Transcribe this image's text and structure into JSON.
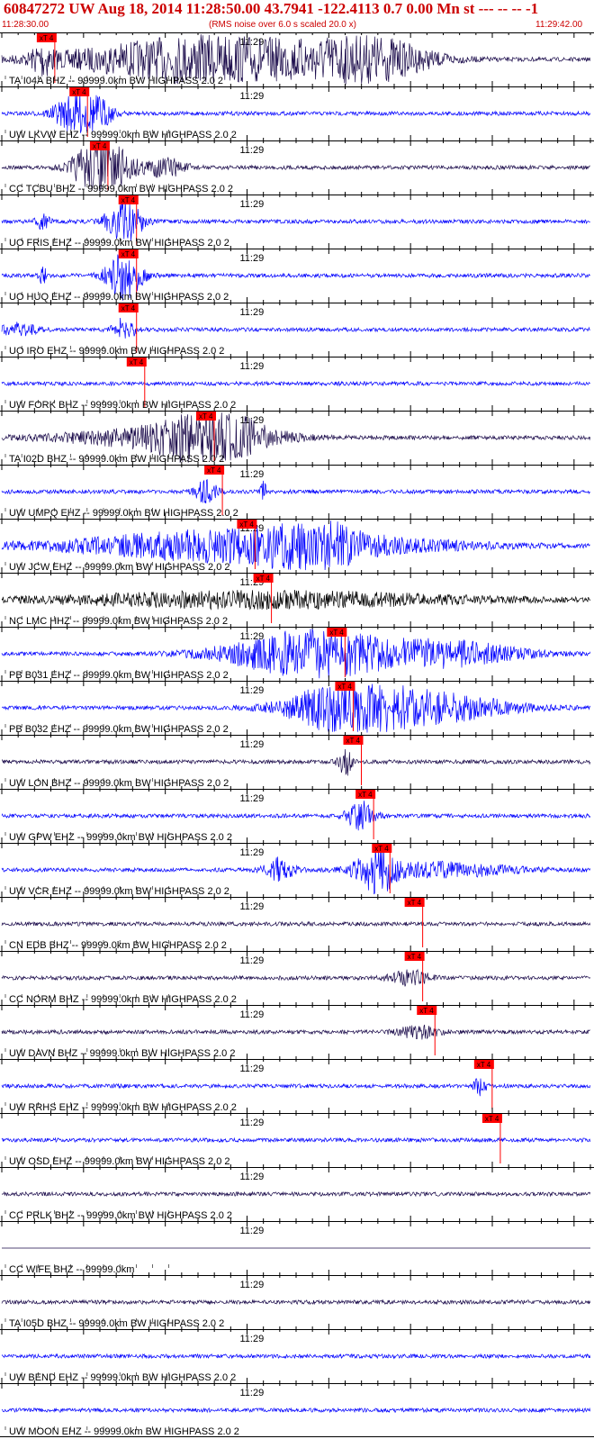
{
  "header": {
    "title": "60847272 UW Aug 18, 2014 11:28:50.00   43.7941 -122.4113  0.7 0.00 Mn st --- -- --  -1",
    "start_time": "11:28:30.00",
    "note": "(RMS noise over 6.0 s scaled 20.0 x)",
    "end_time": "11:29:42.00"
  },
  "colors": {
    "header_text": "#cc0000",
    "pick": "#ff0000",
    "trace_blue": "#0000ff",
    "trace_dark": "#1a0a4a",
    "trace_black": "#000000"
  },
  "chart_data": {
    "type": "line",
    "x_start": "11:28:30.00",
    "x_end": "11:29:42.00",
    "minute_tick_label": "11:29",
    "pick_label": "xT 4",
    "traces": [
      {
        "label": "TA I04A BHZ -- 99999.0km BW  HIGHPASS  2.0  2",
        "color": "#1a0a4a",
        "pick_s": 4.5,
        "events": [
          [
            5,
            1.5,
            0.6
          ],
          [
            22,
            1,
            0.5
          ],
          [
            26,
            20,
            1.0
          ],
          [
            45,
            8,
            0.8
          ]
        ]
      },
      {
        "label": "UW LKVW EHZ -- 99999.0km BW  HIGHPASS  2.0  2",
        "color": "#0000ff",
        "pick_s": 8.5,
        "events": [
          [
            9,
            3,
            0.8
          ],
          [
            12,
            2,
            0.5
          ]
        ]
      },
      {
        "label": "CC TCBU BHZ -- 99999.0km BW  HIGHPASS  2.0  2",
        "color": "#1a0a4a",
        "pick_s": 11,
        "events": [
          [
            11,
            3,
            0.9
          ],
          [
            14,
            3,
            0.7
          ],
          [
            20,
            3,
            0.4
          ]
        ]
      },
      {
        "label": "UO FRIS EHZ -- 99999.0km BW  HIGHPASS  2.0  2",
        "color": "#0000ff",
        "pick_s": 14.5,
        "events": [
          [
            15,
            2.5,
            1.0
          ],
          [
            5,
            1,
            0.3
          ]
        ]
      },
      {
        "label": "UO HUQ EHZ -- 99999.0km BW  HIGHPASS  2.0  2",
        "color": "#0000ff",
        "pick_s": 14.5,
        "events": [
          [
            15,
            2.5,
            1.0
          ],
          [
            5,
            0.5,
            0.4
          ]
        ]
      },
      {
        "label": "UO IRO EHZ -- 99999.0km BW  HIGHPASS  2.0  2",
        "color": "#0000ff",
        "pick_s": 14.5,
        "events": [
          [
            15,
            1.5,
            0.5
          ],
          [
            2,
            3,
            0.25
          ]
        ]
      },
      {
        "label": "UW FORK BHZ -- 99999.0km BW  HIGHPASS  2.0  2",
        "color": "#0000ff",
        "pick_s": 15.5,
        "events": []
      },
      {
        "label": "TA I02D BHZ -- 99999.0km BW  HIGHPASS  2.0  2",
        "color": "#1a0a4a",
        "pick_s": 24,
        "events": [
          [
            20,
            15,
            0.4
          ],
          [
            26,
            7,
            1.0
          ]
        ]
      },
      {
        "label": "UW UMPQ EHZ -- 99999.0km BW  HIGHPASS  2.0  2",
        "color": "#0000ff",
        "pick_s": 25,
        "events": [
          [
            25,
            1.5,
            0.5
          ],
          [
            32,
            0.5,
            0.4
          ]
        ]
      },
      {
        "label": "UW JCW EHZ -- 99999.0km BW  HIGHPASS  2.0  2",
        "color": "#0000ff",
        "pick_s": 29,
        "events": [
          [
            30,
            25,
            0.7
          ],
          [
            38,
            5,
            0.9
          ]
        ]
      },
      {
        "label": "NC LMC HHZ -- 99999.0km BW  HIGHPASS  2.0  2",
        "color": "#000000",
        "pick_s": 31,
        "events": [
          [
            32,
            30,
            0.35
          ]
        ]
      },
      {
        "label": "PB B031 EHZ -- 99999.0km BW  HIGHPASS  2.0  2",
        "color": "#0000ff",
        "pick_s": 40,
        "events": [
          [
            38,
            12,
            1.0
          ],
          [
            55,
            10,
            0.5
          ]
        ]
      },
      {
        "label": "PB B032 EHZ -- 99999.0km BW  HIGHPASS  2.0  2",
        "color": "#0000ff",
        "pick_s": 41,
        "events": [
          [
            42,
            8,
            1.0
          ],
          [
            52,
            12,
            0.6
          ]
        ]
      },
      {
        "label": "UW LON BHZ -- 99999.0km BW  HIGHPASS  2.0  2",
        "color": "#1a0a4a",
        "pick_s": 42,
        "events": [
          [
            42,
            1,
            0.6
          ]
        ]
      },
      {
        "label": "UW GPW EHZ -- 99999.0km BW  HIGHPASS  2.0  2",
        "color": "#0000ff",
        "pick_s": 43.5,
        "events": [
          [
            44,
            2,
            0.6
          ]
        ]
      },
      {
        "label": "UW VCR EHZ -- 99999.0km BW  HIGHPASS  2.0  2",
        "color": "#0000ff",
        "pick_s": 45.5,
        "events": [
          [
            46,
            3,
            1.0
          ],
          [
            34,
            2,
            0.5
          ],
          [
            54,
            10,
            0.3
          ]
        ]
      },
      {
        "label": "CN EDB BHZ -- 99999.0km BW  HIGHPASS  2.0  2",
        "color": "#1a0a4a",
        "pick_s": 49.5,
        "events": []
      },
      {
        "label": "CC NORM BHZ -- 99999.0km BW  HIGHPASS  2.0  2",
        "color": "#1a0a4a",
        "pick_s": 49.5,
        "events": [
          [
            50,
            3,
            0.3
          ]
        ]
      },
      {
        "label": "UW DAVN BHZ -- 99999.0km BW  HIGHPASS  2.0  2",
        "color": "#1a0a4a",
        "pick_s": 51,
        "events": [
          [
            51,
            3,
            0.25
          ]
        ]
      },
      {
        "label": "UW RRHS EHZ -- 99999.0km BW  HIGHPASS  2.0  2",
        "color": "#0000ff",
        "pick_s": 58,
        "events": [
          [
            58.5,
            0.8,
            0.4
          ]
        ]
      },
      {
        "label": "UW OSD EHZ -- 99999.0km BW  HIGHPASS  2.0  2",
        "color": "#0000ff",
        "pick_s": 59,
        "events": []
      },
      {
        "label": "CC PRLK BHZ -- 99999.0km BW  HIGHPASS  2.0  2",
        "color": "#1a0a4a",
        "pick_s": null,
        "events": []
      },
      {
        "label": "CC WIFE BHZ -- 99999.0km",
        "color": "#1a0a4a",
        "pick_s": null,
        "events": []
      },
      {
        "label": "TA I05D BHZ -- 99999.0km BW  HIGHPASS  2.0  2",
        "color": "#1a0a4a",
        "pick_s": null,
        "events": []
      },
      {
        "label": "UW BEND EHZ -- 99999.0km BW  HIGHPASS  2.0  2",
        "color": "#0000ff",
        "pick_s": null,
        "events": []
      },
      {
        "label": "UW MOON EHZ -- 99999.0km BW  HIGHPASS  2.0  2",
        "color": "#0000ff",
        "pick_s": null,
        "events": []
      }
    ]
  }
}
